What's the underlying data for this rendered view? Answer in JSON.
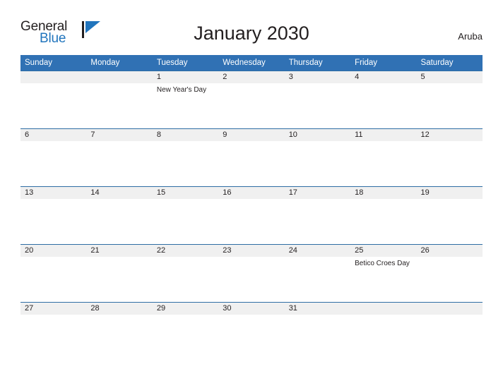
{
  "brand": {
    "line1": "General",
    "line2": "Blue",
    "flag_icon": "blue-triangle-flag-icon",
    "accent_color": "#2175bd"
  },
  "header": {
    "title": "January 2030",
    "country": "Aruba"
  },
  "calendar": {
    "header_bg": "#3071b4",
    "row_separator_color": "#2e6da4",
    "daynum_band_bg": "#f0f0f0",
    "weekday_headers": [
      "Sunday",
      "Monday",
      "Tuesday",
      "Wednesday",
      "Thursday",
      "Friday",
      "Saturday"
    ],
    "weeks": [
      [
        {
          "day": "",
          "event": ""
        },
        {
          "day": "",
          "event": ""
        },
        {
          "day": "1",
          "event": "New Year's Day"
        },
        {
          "day": "2",
          "event": ""
        },
        {
          "day": "3",
          "event": ""
        },
        {
          "day": "4",
          "event": ""
        },
        {
          "day": "5",
          "event": ""
        }
      ],
      [
        {
          "day": "6",
          "event": ""
        },
        {
          "day": "7",
          "event": ""
        },
        {
          "day": "8",
          "event": ""
        },
        {
          "day": "9",
          "event": ""
        },
        {
          "day": "10",
          "event": ""
        },
        {
          "day": "11",
          "event": ""
        },
        {
          "day": "12",
          "event": ""
        }
      ],
      [
        {
          "day": "13",
          "event": ""
        },
        {
          "day": "14",
          "event": ""
        },
        {
          "day": "15",
          "event": ""
        },
        {
          "day": "16",
          "event": ""
        },
        {
          "day": "17",
          "event": ""
        },
        {
          "day": "18",
          "event": ""
        },
        {
          "day": "19",
          "event": ""
        }
      ],
      [
        {
          "day": "20",
          "event": ""
        },
        {
          "day": "21",
          "event": ""
        },
        {
          "day": "22",
          "event": ""
        },
        {
          "day": "23",
          "event": ""
        },
        {
          "day": "24",
          "event": ""
        },
        {
          "day": "25",
          "event": "Betico Croes Day"
        },
        {
          "day": "26",
          "event": ""
        }
      ],
      [
        {
          "day": "27",
          "event": ""
        },
        {
          "day": "28",
          "event": ""
        },
        {
          "day": "29",
          "event": ""
        },
        {
          "day": "30",
          "event": ""
        },
        {
          "day": "31",
          "event": ""
        },
        {
          "day": "",
          "event": ""
        },
        {
          "day": "",
          "event": ""
        }
      ]
    ]
  }
}
